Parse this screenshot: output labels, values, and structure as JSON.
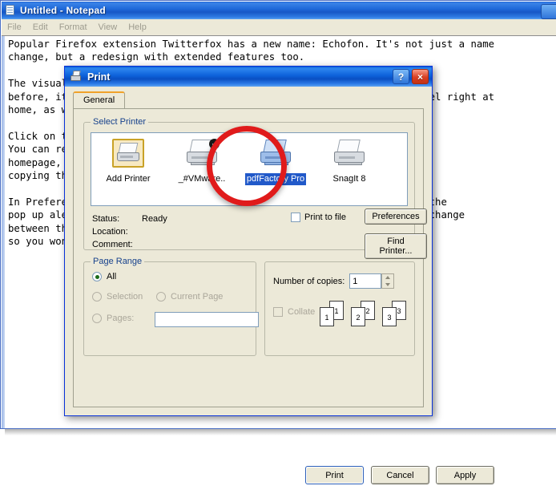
{
  "notepad": {
    "title": "Untitled - Notepad",
    "icon": "notepad-document-icon",
    "menu": [
      "File",
      "Edit",
      "Format",
      "View",
      "Help"
    ],
    "text": "Popular Firefox extension Twitterfox has a new name: Echofon. It's not just a name\nchange, but a redesign with extended features too.\n\nThe visual overhaul isn't drastic, the interface is just as friendly as\nbefore, it retains the same layout so existing Twitterfox users will feel right at\nhome, as well as the same great functionality.\n\nClick on the icon and the Twitter interface pops up in Firefox.\nYou can read and write tweets as you can do from the Twitter\nhomepage, including retweeting, favoriting, replying and\ncopying the tweet link.\n\nIn Preferences you can set tweets to pop up alerts (in real time), and the\npop up alerts to stay on screen for a set number of seconds on it, and change\nbetween the light and dark theme. Your settings will sync with Firefox,\nso you won't lose them."
  },
  "dialog": {
    "title": "Print",
    "icon": "printer-icon",
    "help_button": "?",
    "close_button": "×",
    "tabs": [
      {
        "label": "General",
        "active": true
      }
    ],
    "select_printer": {
      "legend": "Select Printer",
      "printers": [
        {
          "name": "Add Printer",
          "icon": "add-printer-icon",
          "selected": false,
          "default": false,
          "variant": "add"
        },
        {
          "name": "_#VMware..",
          "icon": "printer-icon",
          "selected": false,
          "default": true,
          "variant": "gray"
        },
        {
          "name": "pdfFactory Pro",
          "icon": "printer-icon",
          "selected": true,
          "default": false,
          "variant": "blue"
        },
        {
          "name": "SnagIt 8",
          "icon": "printer-icon",
          "selected": false,
          "default": false,
          "variant": "gray"
        }
      ],
      "status_label": "Status:",
      "status_value": "Ready",
      "location_label": "Location:",
      "location_value": "",
      "comment_label": "Comment:",
      "comment_value": "",
      "print_to_file_label": "Print to file",
      "print_to_file_checked": false,
      "preferences_label": "Preferences",
      "find_printer_label": "Find Printer..."
    },
    "page_range": {
      "legend": "Page Range",
      "options": [
        {
          "label": "All",
          "checked": true,
          "enabled": true
        },
        {
          "label": "Selection",
          "checked": false,
          "enabled": false
        },
        {
          "label": "Current Page",
          "checked": false,
          "enabled": false
        },
        {
          "label": "Pages:",
          "checked": false,
          "enabled": false
        }
      ],
      "pages_value": "",
      "pages_placeholder": ""
    },
    "copies": {
      "copies_label": "Number of copies:",
      "copies_value": "1",
      "collate_label": "Collate",
      "collate_checked": false,
      "collate_enabled": false,
      "collate_sheets": [
        "1",
        "2",
        "3"
      ]
    },
    "footer": {
      "print_label": "Print",
      "cancel_label": "Cancel",
      "apply_label": "Apply"
    }
  },
  "annotation": {
    "type": "highlight-circle",
    "color": "#e01b1b",
    "target": "pdfFactory Pro"
  }
}
